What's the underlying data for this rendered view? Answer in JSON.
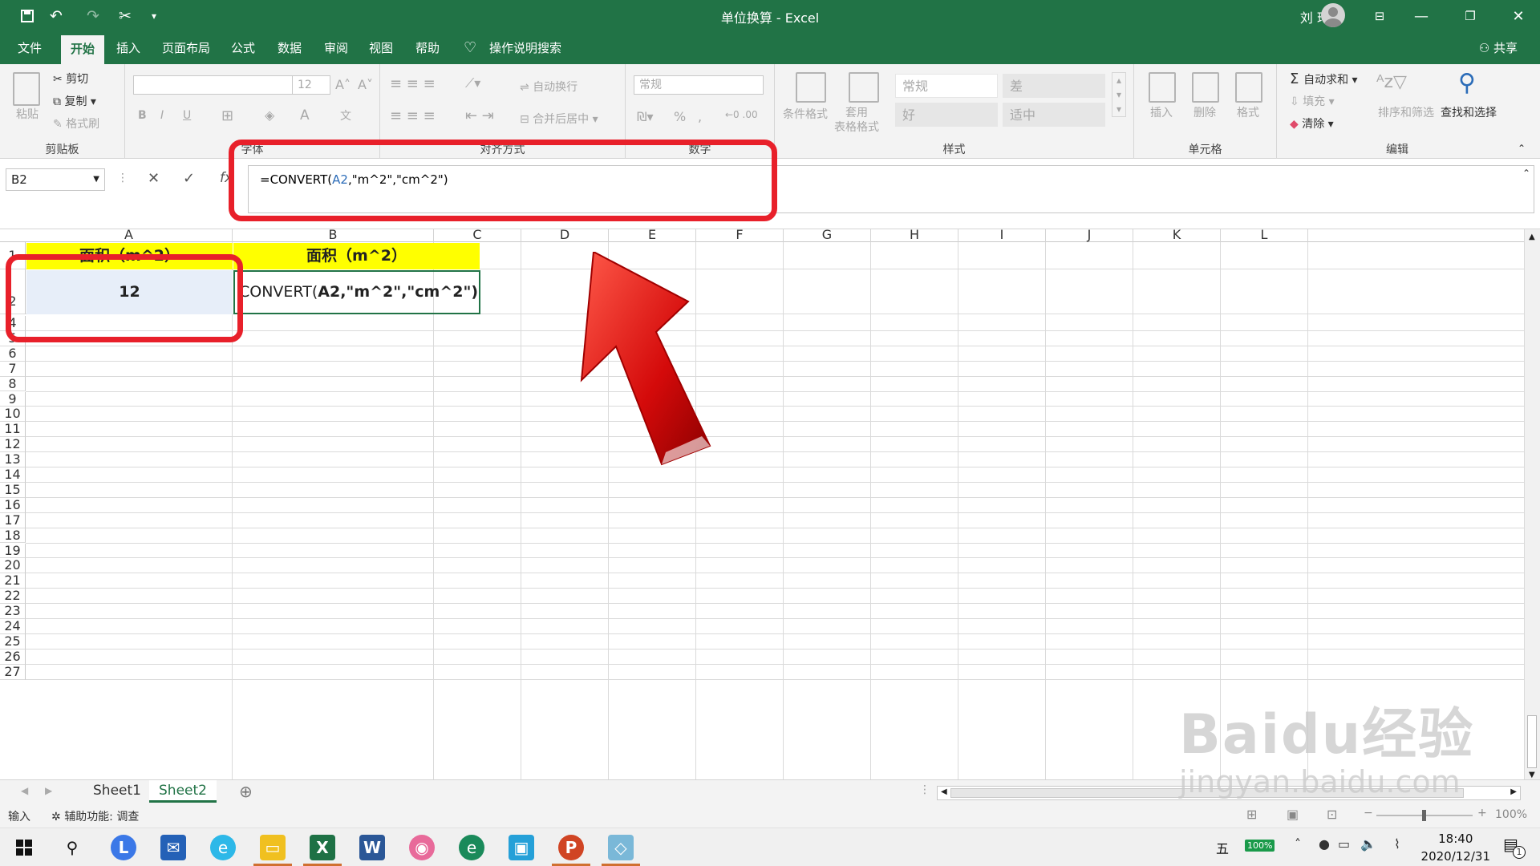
{
  "window": {
    "title": "单位换算 - Excel",
    "user": "刘 玲"
  },
  "quick_access": {
    "save": "save-icon",
    "undo": "undo-icon",
    "redo": "redo-icon",
    "cut": "scissors-icon"
  },
  "menu": {
    "file": "文件",
    "tabs": [
      "开始",
      "插入",
      "页面布局",
      "公式",
      "数据",
      "审阅",
      "视图",
      "帮助"
    ],
    "tell_me": "操作说明搜索",
    "share": "共享"
  },
  "ribbon": {
    "clipboard": {
      "paste": "粘贴",
      "cut": "剪切",
      "copy": "复制",
      "format_painter": "格式刷",
      "name": "剪贴板"
    },
    "font": {
      "font_size": "12",
      "bold": "B",
      "italic": "I",
      "underline": "U",
      "name": "字体"
    },
    "alignment": {
      "wrap": "自动换行",
      "merge": "合并后居中",
      "name": "对齐方式"
    },
    "number": {
      "format": "常规",
      "percent": "%",
      "name": "数字"
    },
    "styles": {
      "conditional": "条件格式",
      "table_format": "套用\n表格格式",
      "cells": [
        "常规",
        "差",
        "好",
        "适中"
      ],
      "name": "样式"
    },
    "cells": {
      "insert": "插入",
      "delete": "删除",
      "format": "格式",
      "name": "单元格"
    },
    "editing": {
      "autosum": "自动求和",
      "fill": "填充",
      "clear": "清除",
      "sort": "排序和筛选",
      "find": "查找和选择",
      "name": "编辑"
    }
  },
  "formula_bar": {
    "name_box": "B2",
    "formula_prefix": "=CONVERT(",
    "formula_ref": "A2",
    "formula_suffix": ",\"m^2\",\"cm^2\")"
  },
  "sheet": {
    "columns": [
      "A",
      "B",
      "C",
      "D",
      "E",
      "F",
      "G",
      "H",
      "I",
      "J",
      "K",
      "L"
    ],
    "rows": [
      "1",
      "2",
      "4",
      "5",
      "6",
      "7",
      "8",
      "9",
      "10",
      "11",
      "12",
      "13",
      "14",
      "15",
      "16",
      "17",
      "18",
      "19",
      "20",
      "21",
      "22",
      "23",
      "24",
      "25",
      "26",
      "27"
    ],
    "a1": "面积（m^2）",
    "b1": "面积（m^2）",
    "a2": "12",
    "b2_prefix": "CONVERT(",
    "b2_rest": "A2,\"m^2\",\"cm^2\")"
  },
  "sheet_tabs": [
    "Sheet1",
    "Sheet2"
  ],
  "status": {
    "mode": "输入",
    "accessibility": "辅助功能: 调查",
    "zoom": "100%"
  },
  "taskbar": {
    "ime": "五",
    "battery": "100%",
    "time": "18:40",
    "date": "2020/12/31",
    "notification_count": "1"
  },
  "watermark": {
    "brand": "Baidu经验",
    "url": "jingyan.baidu.com"
  },
  "colors": {
    "excel_green": "#217346",
    "highlight_yellow": "#ffff00",
    "annotation_red": "#e8202a"
  }
}
